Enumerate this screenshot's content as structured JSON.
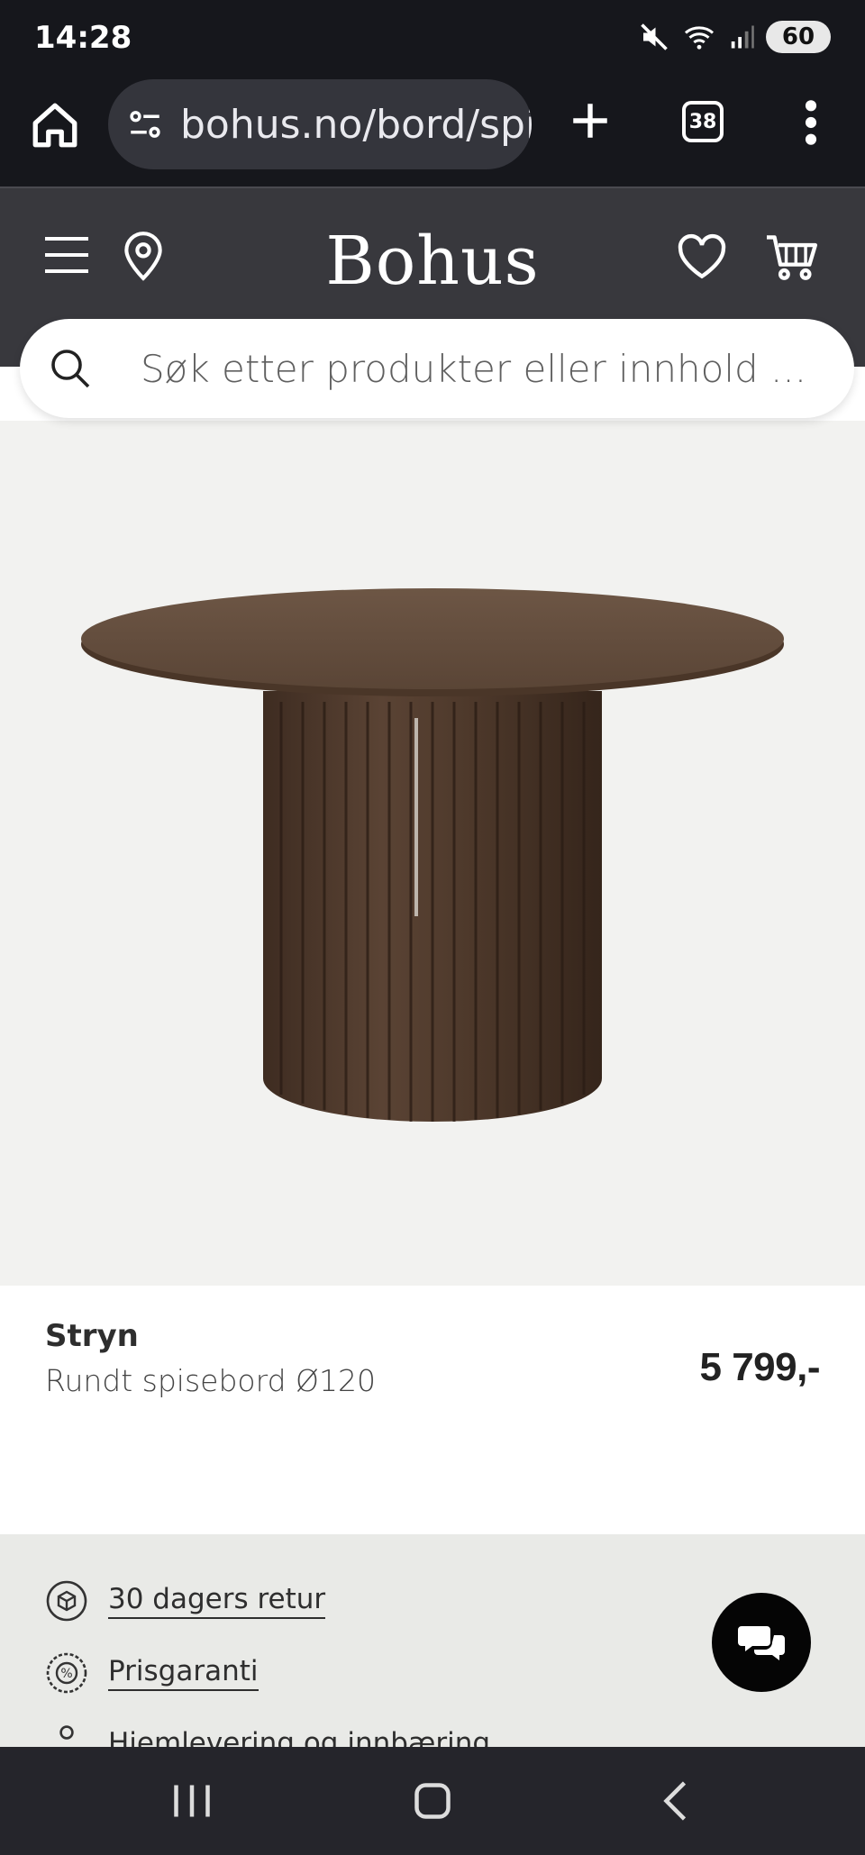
{
  "status": {
    "time": "14:28",
    "battery": "60"
  },
  "browser": {
    "url": "bohus.no/bord/spis",
    "tab_count": "38"
  },
  "header": {
    "logo": "Bohus"
  },
  "search": {
    "placeholder": "Søk etter produkter eller innhold ..."
  },
  "product": {
    "name": "Stryn",
    "description": "Rundt spisebord Ø120",
    "price": "5 799,-"
  },
  "benefits": [
    {
      "label": "30 dagers retur",
      "icon": "return-box-icon"
    },
    {
      "label": "Prisgaranti",
      "icon": "price-guarantee-icon"
    },
    {
      "label": "Hjemlevering og innbæring",
      "icon": "delivery-person-icon"
    }
  ],
  "colors": {
    "header_bg": "#38383d",
    "browser_bg": "#16171c",
    "benefits_bg": "#e9eae7",
    "chat_bg": "#050505"
  }
}
